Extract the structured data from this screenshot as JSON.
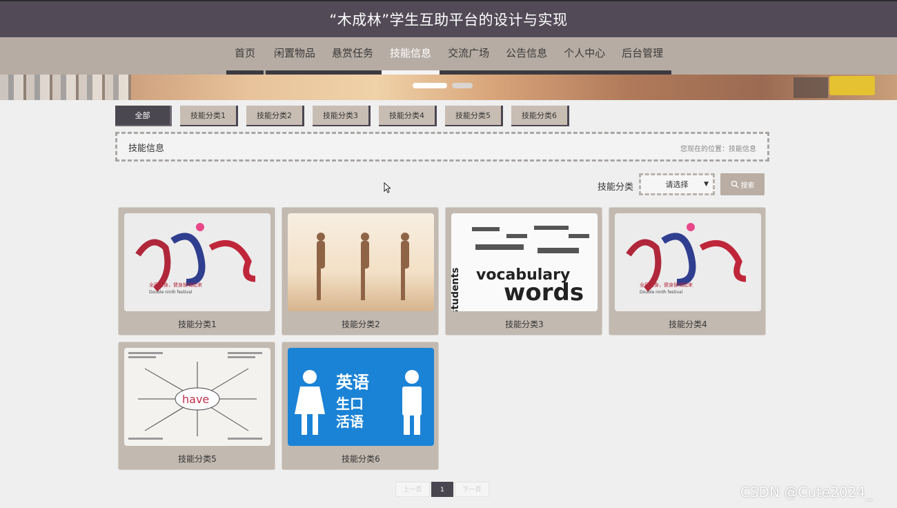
{
  "header": {
    "title": "“木成林”学生互助平台的设计与实现"
  },
  "nav": {
    "items": [
      {
        "label": "首页"
      },
      {
        "label": "闲置物品"
      },
      {
        "label": "悬赏任务"
      },
      {
        "label": "技能信息",
        "active": true
      },
      {
        "label": "交流广场"
      },
      {
        "label": "公告信息"
      },
      {
        "label": "个人中心"
      },
      {
        "label": "后台管理"
      }
    ]
  },
  "tabs": [
    "全部",
    "技能分类1",
    "技能分类2",
    "技能分类3",
    "技能分类4",
    "技能分类5",
    "技能分类6"
  ],
  "breadcrumb": {
    "section": "技能信息",
    "location": "您现在的位置：技能信息"
  },
  "filter": {
    "label": "技能分类",
    "select_value": "请选择",
    "search_label": "搜索"
  },
  "cards": [
    {
      "label": "技能分类1",
      "image": "fitness-poster"
    },
    {
      "label": "技能分类2",
      "image": "yoga-women"
    },
    {
      "label": "技能分类3",
      "image": "vocabulary-word-cloud"
    },
    {
      "label": "技能分类4",
      "image": "fitness-poster"
    },
    {
      "label": "技能分类5",
      "image": "have-mind-map"
    },
    {
      "label": "技能分类6",
      "image": "english-oral-sign"
    }
  ],
  "images": {
    "fitness_title": "健身操",
    "fitness_sub": "全民健身，健身操嗨起来",
    "fitness_en": "Double ninth festival",
    "words_big": "words",
    "words_mid": "vocabulary",
    "words_side": "students",
    "have_word": "have",
    "english_top": "英语",
    "english_bottom_1": "生口",
    "english_bottom_2": "活语"
  },
  "pager": {
    "prev": "上一页",
    "current": "1",
    "next": "下一页"
  },
  "watermark": "CSDN @Cute2024_"
}
